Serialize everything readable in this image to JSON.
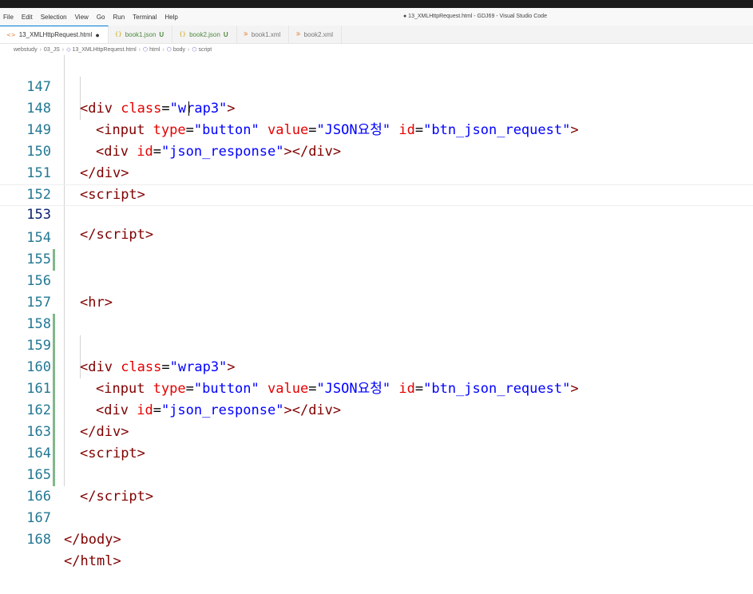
{
  "window": {
    "title": "● 13_XMLHttpRequest.html - GDJ69 - Visual Studio Code"
  },
  "menu": [
    "File",
    "Edit",
    "Selection",
    "View",
    "Go",
    "Run",
    "Terminal",
    "Help"
  ],
  "tabs": [
    {
      "icon": "<>",
      "label": "13_XMLHttpRequest.html",
      "badge": "",
      "dirty": "●"
    },
    {
      "icon": "{}",
      "label": "book1.json",
      "badge": "U",
      "dirty": ""
    },
    {
      "icon": "{}",
      "label": "book2.json",
      "badge": "U",
      "dirty": ""
    },
    {
      "icon": "⚞",
      "label": "book1.xml",
      "badge": "",
      "dirty": ""
    },
    {
      "icon": "⚞",
      "label": "book2.xml",
      "badge": "",
      "dirty": ""
    }
  ],
  "breadcrumb": [
    "webstudy",
    "03_JS",
    "13_XMLHttpRequest.html",
    "html",
    "body",
    "script"
  ],
  "lines": [
    {
      "num": "147",
      "tokens": {
        "t0": "<",
        "t1": "div",
        "a1": " class",
        "p1": "=",
        "s1": "\"wrap3\"",
        "t2": ">"
      }
    },
    {
      "num": "148",
      "tokens": {
        "t0": "<",
        "t1": "input",
        "a1": " type",
        "p1": "=",
        "s1": "\"button\"",
        "a2": " value",
        "p2": "=",
        "s2": "\"JSON요청\"",
        "a3": " id",
        "p3": "=",
        "s3": "\"btn_json_request\"",
        "t2": ">"
      }
    },
    {
      "num": "149",
      "tokens": {
        "t0": "<",
        "t1": "div",
        "a1": " id",
        "p1": "=",
        "s1": "\"json_response\"",
        "t2": "></",
        "t3": "div",
        "t4": ">"
      }
    },
    {
      "num": "150",
      "tokens": {
        "t0": "</",
        "t1": "div",
        "t2": ">"
      }
    },
    {
      "num": "151",
      "tokens": {
        "t0": "<",
        "t1": "script",
        "t2": ">"
      }
    },
    {
      "num": "152",
      "tokens": {}
    },
    {
      "num": "153",
      "tokens": {
        "t0": "</",
        "t1": "script",
        "t2": ">"
      }
    },
    {
      "num": "154",
      "tokens": {}
    },
    {
      "num": "155",
      "tokens": {}
    },
    {
      "num": "156",
      "tokens": {
        "t0": "<",
        "t1": "hr",
        "t2": ">"
      }
    },
    {
      "num": "157",
      "tokens": {}
    },
    {
      "num": "158",
      "tokens": {}
    },
    {
      "num": "159",
      "tokens": {
        "t0": "<",
        "t1": "div",
        "a1": " class",
        "p1": "=",
        "s1": "\"wrap3\"",
        "t2": ">"
      }
    },
    {
      "num": "160",
      "tokens": {
        "t0": "<",
        "t1": "input",
        "a1": " type",
        "p1": "=",
        "s1": "\"button\"",
        "a2": " value",
        "p2": "=",
        "s2": "\"JSON요청\"",
        "a3": " id",
        "p3": "=",
        "s3": "\"btn_json_request\"",
        "t2": ">"
      }
    },
    {
      "num": "161",
      "tokens": {
        "t0": "<",
        "t1": "div",
        "a1": " id",
        "p1": "=",
        "s1": "\"json_response\"",
        "t2": "></",
        "t3": "div",
        "t4": ">"
      }
    },
    {
      "num": "162",
      "tokens": {
        "t0": "</",
        "t1": "div",
        "t2": ">"
      }
    },
    {
      "num": "163",
      "tokens": {
        "t0": "<",
        "t1": "script",
        "t2": ">"
      }
    },
    {
      "num": "164",
      "tokens": {}
    },
    {
      "num": "165",
      "tokens": {
        "t0": "</",
        "t1": "script",
        "t2": ">"
      }
    },
    {
      "num": "166",
      "tokens": {}
    },
    {
      "num": "167",
      "tokens": {
        "t0": "</",
        "t1": "body",
        "t2": ">"
      }
    },
    {
      "num": "168",
      "tokens": {
        "t0": "</",
        "t1": "html",
        "t2": ">"
      }
    }
  ],
  "colors": {
    "tag": "#800000",
    "attr": "#e50000",
    "string": "#0000ff",
    "line_number": "#237893",
    "git_added": "#81b88b"
  }
}
